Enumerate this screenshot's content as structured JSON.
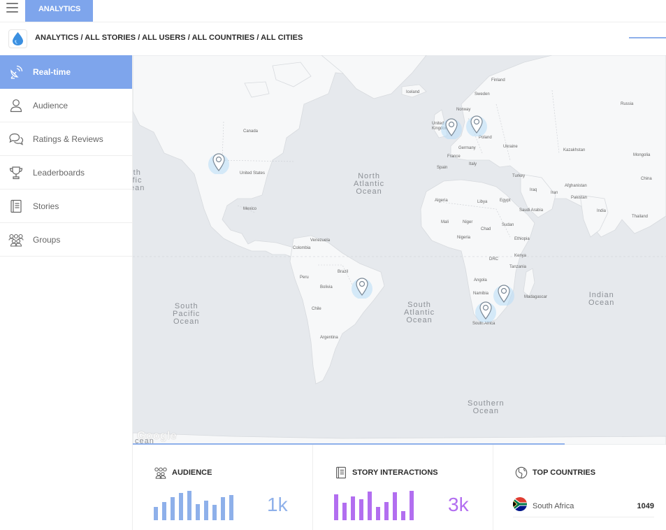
{
  "topbar": {
    "app_tab": "ANALYTICS"
  },
  "breadcrumb": {
    "text": "ANALYTICS / ALL STORIES / ALL USERS / ALL COUNTRIES / ALL CITIES"
  },
  "sidebar": {
    "items": [
      {
        "label": "Real-time",
        "icon": "satellite-icon",
        "active": true
      },
      {
        "label": "Audience",
        "icon": "person-icon",
        "active": false
      },
      {
        "label": "Ratings & Reviews",
        "icon": "chat-bubbles-icon",
        "active": false
      },
      {
        "label": "Leaderboards",
        "icon": "trophy-icon",
        "active": false
      },
      {
        "label": "Stories",
        "icon": "book-icon",
        "active": false
      },
      {
        "label": "Groups",
        "icon": "group-icon",
        "active": false
      }
    ]
  },
  "map": {
    "oceans": {
      "north_pacific": "rth\nific\nean",
      "north_atlantic": "North\nAtlantic\nOcean",
      "south_pacific": "South\nPacific\nOcean",
      "south_atlantic": "South\nAtlantic\nOcean",
      "indian": "Indian\nOcean",
      "southern": "Southern\nOcean",
      "corner": "cean"
    },
    "labels": {
      "canada": "Canada",
      "united_states": "United States",
      "mexico": "Mexico",
      "venezuela": "Venezuela",
      "colombia": "Colombia",
      "peru": "Peru",
      "brazil": "Brazil",
      "bolivia": "Bolivia",
      "chile": "Chile",
      "argentina": "Argentina",
      "iceland": "Iceland",
      "sweden": "Sweden",
      "finland": "Finland",
      "norway": "Norway",
      "united_kingdom": "United\nKingdom",
      "poland": "Poland",
      "germany": "Germany",
      "france": "France",
      "spain": "Spain",
      "italy": "Italy",
      "ukraine": "Ukraine",
      "russia": "Russia",
      "kazakhstan": "Kazakhstan",
      "mongolia": "Mongolia",
      "china": "China",
      "turkey": "Turkey",
      "iraq": "Iraq",
      "iran": "Iran",
      "afghanistan": "Afghanistan",
      "pakistan": "Pakistan",
      "india": "India",
      "thailand": "Thailand",
      "algeria": "Algeria",
      "libya": "Libya",
      "egypt": "Egypt",
      "saudi_arabia": "Saudi Arabia",
      "mali": "Mali",
      "niger": "Niger",
      "chad": "Chad",
      "sudan": "Sudan",
      "nigeria": "Nigeria",
      "ethiopia": "Ethiopia",
      "drc": "DRC",
      "kenya": "Kenya",
      "tanzania": "Tanzania",
      "angola": "Angola",
      "namibia": "Namibia",
      "madagascar": "Madagascar",
      "south_africa": "South Africa"
    },
    "google_logo": "Google",
    "loading_progress": 0.81
  },
  "cards": {
    "audience": {
      "title": "AUDIENCE",
      "value": "1k",
      "color": "#8eb0ea",
      "bars": [
        0.45,
        0.62,
        0.78,
        0.92,
        1.0,
        0.55,
        0.66,
        0.52,
        0.78,
        0.85
      ]
    },
    "interactions": {
      "title": "STORY INTERACTIONS",
      "value": "3k",
      "color": "#b26ef0",
      "bars": [
        0.88,
        0.6,
        0.82,
        0.72,
        0.98,
        0.45,
        0.62,
        0.95,
        0.3,
        1.0
      ]
    },
    "top_countries": {
      "title": "TOP COUNTRIES",
      "rows": [
        {
          "name": "South Africa",
          "count": "1049"
        }
      ]
    }
  },
  "colors": {
    "accent": "#7ea5ec",
    "map_water": "#e6e9ed",
    "map_land": "#f7f8f9"
  }
}
